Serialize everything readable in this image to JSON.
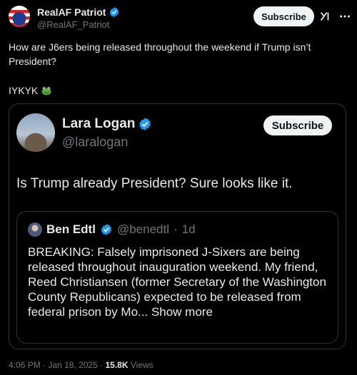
{
  "post": {
    "author_name": "RealAF Patriot",
    "author_handle": "@RealAF_Patriot",
    "subscribe_label": "Subscribe",
    "text": "How are J6ers being released throughout the weekend if Trump isn’t President?",
    "text2": "IYKYK",
    "emoji": "frog-face",
    "verified_color": "#1d9bf0"
  },
  "quote": {
    "author_name": "Lara Logan",
    "author_handle": "@laralogan",
    "subscribe_label": "Subscribe",
    "text": "Is Trump already President? Sure looks like it."
  },
  "inner_quote": {
    "author_name": "Ben Edtl",
    "author_handle": "@benedtl",
    "age": "1d",
    "text": "BREAKING: Falsely imprisoned J-Sixers are being released throughout inauguration weekend. My friend, Reed Christiansen (former Secretary of the Washington County Republicans) expected to be released from federal prison by Mo...",
    "show_more": "Show more"
  },
  "footer": {
    "time": "4:06 PM",
    "date": "Jan 18, 2025",
    "views_count": "15.8K",
    "views_label": "Views"
  }
}
